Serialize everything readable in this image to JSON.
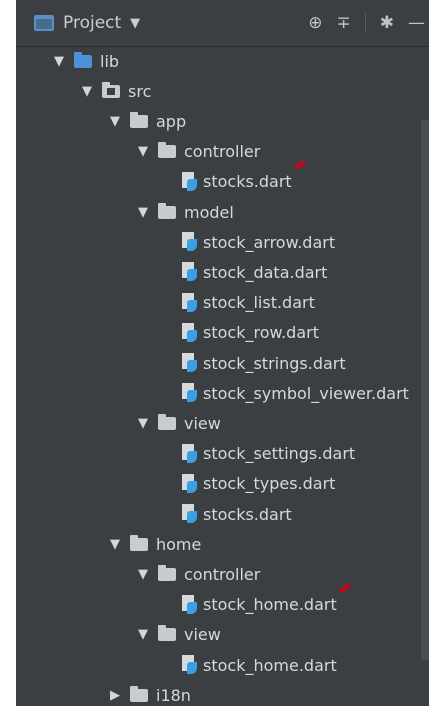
{
  "header": {
    "title": "Project",
    "icons": [
      "project-icon",
      "target-icon",
      "collapse-icon",
      "gear-icon",
      "minimize-icon"
    ]
  },
  "colors": {
    "panel_background": "#3c3f41",
    "text": "#d6d9dc",
    "folder_blue": "#4f90d9",
    "marker_red": "#d0021b"
  },
  "tree": [
    {
      "label": "lib",
      "kind": "folder",
      "expanded": true,
      "depth": 0
    },
    {
      "label": "src",
      "kind": "folder",
      "expanded": true,
      "depth": 1
    },
    {
      "label": "app",
      "kind": "folder",
      "expanded": true,
      "depth": 2
    },
    {
      "label": "controller",
      "kind": "folder",
      "expanded": true,
      "depth": 3
    },
    {
      "label": "stocks.dart",
      "kind": "file",
      "depth": 4,
      "marked": true
    },
    {
      "label": "model",
      "kind": "folder",
      "expanded": true,
      "depth": 3
    },
    {
      "label": "stock_arrow.dart",
      "kind": "file",
      "depth": 4
    },
    {
      "label": "stock_data.dart",
      "kind": "file",
      "depth": 4
    },
    {
      "label": "stock_list.dart",
      "kind": "file",
      "depth": 4
    },
    {
      "label": "stock_row.dart",
      "kind": "file",
      "depth": 4
    },
    {
      "label": "stock_strings.dart",
      "kind": "file",
      "depth": 4
    },
    {
      "label": "stock_symbol_viewer.dart",
      "kind": "file",
      "depth": 4
    },
    {
      "label": "view",
      "kind": "folder",
      "expanded": true,
      "depth": 3
    },
    {
      "label": "stock_settings.dart",
      "kind": "file",
      "depth": 4
    },
    {
      "label": "stock_types.dart",
      "kind": "file",
      "depth": 4
    },
    {
      "label": "stocks.dart",
      "kind": "file",
      "depth": 4
    },
    {
      "label": "home",
      "kind": "folder",
      "expanded": true,
      "depth": 2
    },
    {
      "label": "controller",
      "kind": "folder",
      "expanded": true,
      "depth": 3
    },
    {
      "label": "stock_home.dart",
      "kind": "file",
      "depth": 4,
      "marked": true
    },
    {
      "label": "view",
      "kind": "folder",
      "expanded": true,
      "depth": 3
    },
    {
      "label": "stock_home.dart",
      "kind": "file",
      "depth": 4
    },
    {
      "label": "i18n",
      "kind": "folder",
      "expanded": false,
      "depth": 2
    }
  ]
}
